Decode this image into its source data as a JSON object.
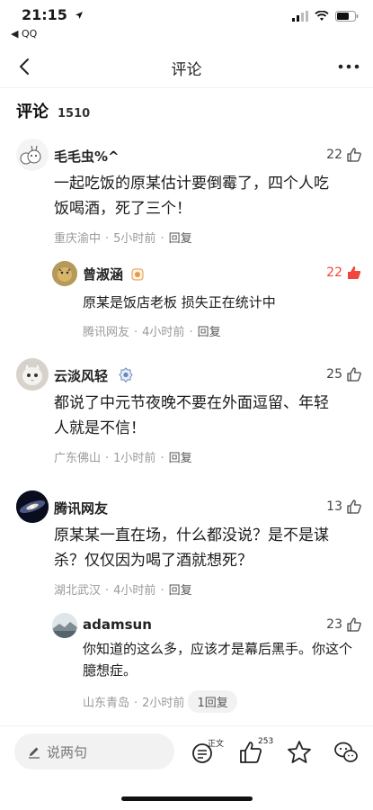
{
  "status": {
    "time": "21:15",
    "back_app": "◀ QQ"
  },
  "nav": {
    "title": "评论"
  },
  "comments_header": {
    "title": "评论",
    "count": "1510"
  },
  "comments": [
    {
      "user": "毛毛虫%^",
      "likes": "22",
      "text": "一起吃饭的原某估计要倒霉了，四个人吃饭喝酒，死了三个！",
      "location": "重庆渝中",
      "time": "5小时前",
      "reply_label": "回复",
      "reply": {
        "user": "曾淑涵",
        "likes": "22",
        "text": "原某是饭店老板 损失正在统计中",
        "location": "腾讯网友",
        "time": "4小时前",
        "reply_label": "回复"
      }
    },
    {
      "user": "云淡风轻",
      "likes": "25",
      "text": "都说了中元节夜晚不要在外面逗留、年轻人就是不信！",
      "location": "广东佛山",
      "time": "1小时前",
      "reply_label": "回复"
    },
    {
      "user": "腾讯网友",
      "likes": "13",
      "text": "原某某一直在场，什么都没说？是不是谋杀？仅仅因为喝了酒就想死？",
      "location": "湖北武汉",
      "time": "4小时前",
      "reply_label": "回复",
      "reply": {
        "user": "adamsun",
        "likes": "23",
        "text": "你知道的这么多，应该才是幕后黑手。你这个臆想症。",
        "location": "山东青岛",
        "time": "2小时前",
        "reply_label": "1回复"
      }
    }
  ],
  "bottom": {
    "input_placeholder": "说两句",
    "text_badge": "正文",
    "like_count": "253"
  },
  "colors": {
    "like_active": "#f0463c",
    "meta": "#9a9a9a"
  }
}
